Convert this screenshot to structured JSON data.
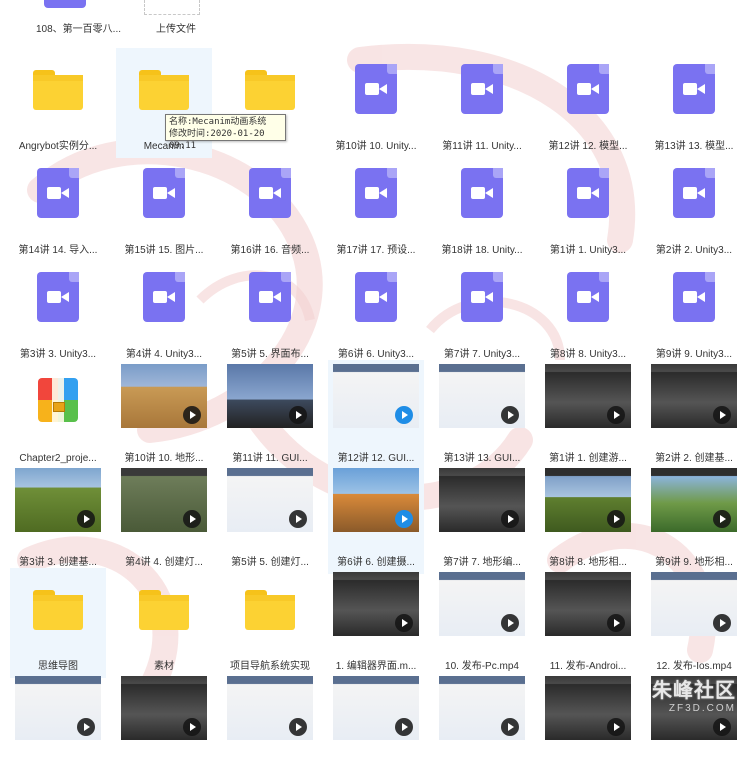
{
  "top_row": {
    "file_label": "108、第一百零八...",
    "upload_label": "上传文件"
  },
  "tooltip": {
    "name_line": "名称:Mecanim动画系统",
    "time_line": "修改时间:2020-01-20 09:11"
  },
  "rows": [
    [
      {
        "type": "folder",
        "label": "Angrybot实例分..."
      },
      {
        "type": "folder",
        "label": "Mecanim",
        "selected": true
      },
      {
        "type": "folder",
        "label": ""
      },
      {
        "type": "video",
        "label": "第10讲 10. Unity..."
      },
      {
        "type": "video",
        "label": "第11讲 11. Unity..."
      },
      {
        "type": "video",
        "label": "第12讲 12. 模型..."
      },
      {
        "type": "video",
        "label": "第13讲 13. 模型..."
      }
    ],
    [
      {
        "type": "video",
        "label": "第14讲 14. 导入..."
      },
      {
        "type": "video",
        "label": "第15讲 15. 图片..."
      },
      {
        "type": "video",
        "label": "第16讲 16. 音频..."
      },
      {
        "type": "video",
        "label": "第17讲 17. 预设..."
      },
      {
        "type": "video",
        "label": "第18讲 18. Unity..."
      },
      {
        "type": "video",
        "label": "第1讲 1. Unity3..."
      },
      {
        "type": "video",
        "label": "第2讲 2. Unity3..."
      }
    ],
    [
      {
        "type": "video",
        "label": "第3讲 3. Unity3..."
      },
      {
        "type": "video",
        "label": "第4讲 4. Unity3..."
      },
      {
        "type": "video",
        "label": "第5讲 5. 界面布..."
      },
      {
        "type": "video",
        "label": "第6讲 6. Unity3..."
      },
      {
        "type": "video",
        "label": "第7讲 7. Unity3..."
      },
      {
        "type": "video",
        "label": "第8讲 8. Unity3..."
      },
      {
        "type": "video",
        "label": "第9讲 9. Unity3..."
      }
    ],
    [
      {
        "type": "zip",
        "label": "Chapter2_proje..."
      },
      {
        "type": "thumb",
        "label": "第10讲 10. 地形...",
        "scene": "desert"
      },
      {
        "type": "thumb",
        "label": "第11讲 11. GUI...",
        "scene": "sky"
      },
      {
        "type": "thumb",
        "label": "第12讲 12. GUI...",
        "scene": "editor",
        "play": "blue",
        "selected": true
      },
      {
        "type": "thumb",
        "label": "第13讲 13. GUI...",
        "scene": "editor"
      },
      {
        "type": "thumb",
        "label": "第1讲 1. 创建游...",
        "scene": "dark"
      },
      {
        "type": "thumb",
        "label": "第2讲 2. 创建基...",
        "scene": "dark"
      }
    ],
    [
      {
        "type": "thumb",
        "label": "第3讲 3. 创建基...",
        "scene": "grass"
      },
      {
        "type": "thumb",
        "label": "第4讲 4. 创建灯...",
        "scene": "darkgrass"
      },
      {
        "type": "thumb",
        "label": "第5讲 5. 创建灯...",
        "scene": "editor"
      },
      {
        "type": "thumb",
        "label": "第6讲 6. 创建摄...",
        "scene": "game",
        "play": "blue",
        "selected": true
      },
      {
        "type": "thumb",
        "label": "第7讲 7. 地形编...",
        "scene": "dark"
      },
      {
        "type": "thumb",
        "label": "第8讲 8. 地形相...",
        "scene": "terrain"
      },
      {
        "type": "thumb",
        "label": "第9讲 9. 地形相...",
        "scene": "island"
      }
    ],
    [
      {
        "type": "folder",
        "label": "思维导图",
        "selected": true
      },
      {
        "type": "folder",
        "label": "素材"
      },
      {
        "type": "folder",
        "label": "项目导航系统实现"
      },
      {
        "type": "thumb",
        "label": "1. 编辑器界面.m...",
        "scene": "dark"
      },
      {
        "type": "thumb",
        "label": "10. 发布-Pc.mp4",
        "scene": "editor"
      },
      {
        "type": "thumb",
        "label": "11. 发布-Androi...",
        "scene": "dark"
      },
      {
        "type": "thumb",
        "label": "12. 发布-Ios.mp4",
        "scene": "editor"
      }
    ],
    [
      {
        "type": "thumb",
        "label": "",
        "scene": "editor"
      },
      {
        "type": "thumb",
        "label": "",
        "scene": "dark"
      },
      {
        "type": "thumb",
        "label": "",
        "scene": "editor"
      },
      {
        "type": "thumb",
        "label": "",
        "scene": "editor"
      },
      {
        "type": "thumb",
        "label": "",
        "scene": "editor"
      },
      {
        "type": "thumb",
        "label": "",
        "scene": "dark"
      },
      {
        "type": "thumb",
        "label": "",
        "scene": "dark"
      }
    ]
  ],
  "brand": {
    "name": "朱峰社区",
    "domain": "ZF3D.COM"
  }
}
